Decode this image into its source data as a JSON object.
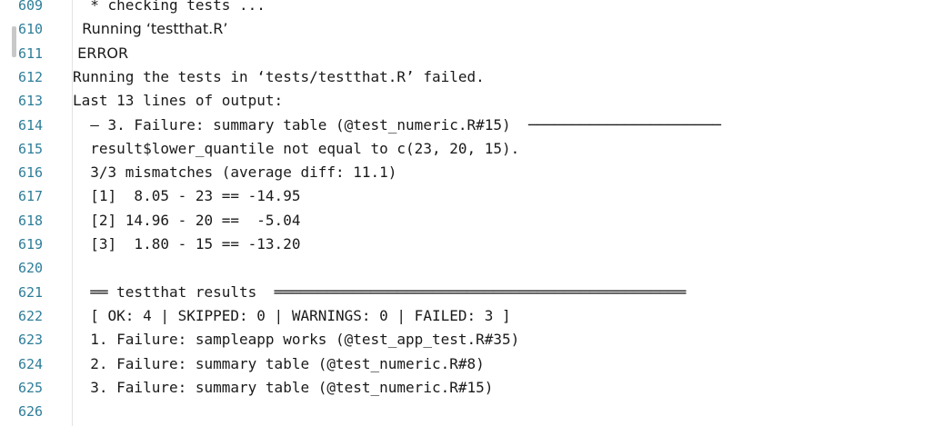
{
  "console": {
    "lines": [
      {
        "number": "609",
        "text": "  * checking tests ...",
        "font": "mono"
      },
      {
        "number": "610",
        "text": "  Running ‘testthat.R’",
        "font": "sans"
      },
      {
        "number": "611",
        "text": " ERROR",
        "font": "sans"
      },
      {
        "number": "612",
        "text": "Running the tests in ‘tests/testthat.R’ failed.",
        "font": "mono"
      },
      {
        "number": "613",
        "text": "Last 13 lines of output:",
        "font": "mono"
      },
      {
        "number": "614",
        "text": "  — 3. Failure: summary table (@test_numeric.R#15)  ──────────────────────",
        "font": "mono"
      },
      {
        "number": "615",
        "text": "  result$lower_quantile not equal to c(23, 20, 15).",
        "font": "mono"
      },
      {
        "number": "616",
        "text": "  3/3 mismatches (average diff: 11.1)",
        "font": "mono"
      },
      {
        "number": "617",
        "text": "  [1]  8.05 - 23 == -14.95",
        "font": "mono"
      },
      {
        "number": "618",
        "text": "  [2] 14.96 - 20 ==  -5.04",
        "font": "mono"
      },
      {
        "number": "619",
        "text": "  [3]  1.80 - 15 == -13.20",
        "font": "mono"
      },
      {
        "number": "620",
        "text": "",
        "font": "mono"
      },
      {
        "number": "621",
        "text": "  ══ testthat results  ═══════════════════════════════════════════════",
        "font": "mono"
      },
      {
        "number": "622",
        "text": "  [ OK: 4 | SKIPPED: 0 | WARNINGS: 0 | FAILED: 3 ]",
        "font": "mono"
      },
      {
        "number": "623",
        "text": "  1. Failure: sampleapp works (@test_app_test.R#35)",
        "font": "mono"
      },
      {
        "number": "624",
        "text": "  2. Failure: summary table (@test_numeric.R#8)",
        "font": "mono"
      },
      {
        "number": "625",
        "text": "  3. Failure: summary table (@test_numeric.R#15)",
        "font": "mono"
      },
      {
        "number": "626",
        "text": "",
        "font": "mono"
      }
    ]
  },
  "colors": {
    "line_number": "#2e7d9a",
    "text": "#1a1a1a",
    "background": "#ffffff",
    "gutter_rule": "#e3e3e3",
    "scroll_marker": "#c8c8c8"
  }
}
